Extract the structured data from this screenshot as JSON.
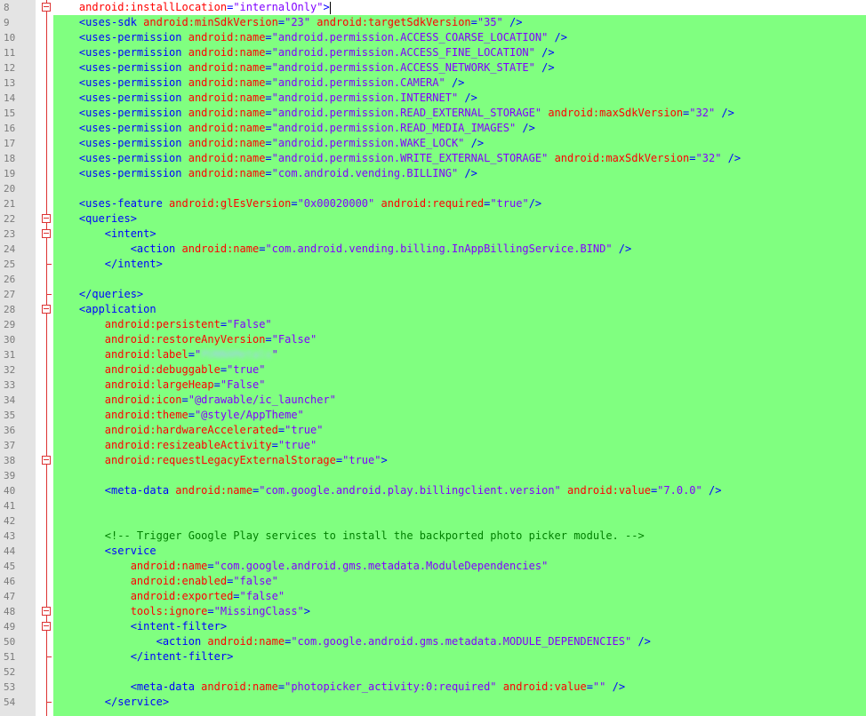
{
  "editor": {
    "lines": [
      {
        "n": "8",
        "fold": "box",
        "segments": [
          {
            "c": "a",
            "t": "    android:installLocation"
          },
          {
            "c": "t",
            "t": "="
          },
          {
            "c": "v",
            "t": "\"internalOnly\""
          },
          {
            "c": "t",
            "t": ">"
          }
        ]
      },
      {
        "n": "9",
        "fold": "",
        "segments": [
          {
            "c": "t",
            "t": "    <uses-sdk "
          },
          {
            "c": "a",
            "t": "android:minSdkVersion"
          },
          {
            "c": "t",
            "t": "="
          },
          {
            "c": "v",
            "t": "\"23\""
          },
          {
            "c": "t",
            "t": " "
          },
          {
            "c": "a",
            "t": "android:targetSdkVersion"
          },
          {
            "c": "t",
            "t": "="
          },
          {
            "c": "v",
            "t": "\"35\""
          },
          {
            "c": "t",
            "t": " />"
          }
        ]
      },
      {
        "n": "10",
        "fold": "",
        "segments": [
          {
            "c": "t",
            "t": "    <uses-permission "
          },
          {
            "c": "a",
            "t": "android:name"
          },
          {
            "c": "t",
            "t": "="
          },
          {
            "c": "v",
            "t": "\"android.permission.ACCESS_COARSE_LOCATION\""
          },
          {
            "c": "t",
            "t": " />"
          }
        ]
      },
      {
        "n": "11",
        "fold": "",
        "segments": [
          {
            "c": "t",
            "t": "    <uses-permission "
          },
          {
            "c": "a",
            "t": "android:name"
          },
          {
            "c": "t",
            "t": "="
          },
          {
            "c": "v",
            "t": "\"android.permission.ACCESS_FINE_LOCATION\""
          },
          {
            "c": "t",
            "t": " />"
          }
        ]
      },
      {
        "n": "12",
        "fold": "",
        "segments": [
          {
            "c": "t",
            "t": "    <uses-permission "
          },
          {
            "c": "a",
            "t": "android:name"
          },
          {
            "c": "t",
            "t": "="
          },
          {
            "c": "v",
            "t": "\"android.permission.ACCESS_NETWORK_STATE\""
          },
          {
            "c": "t",
            "t": " />"
          }
        ]
      },
      {
        "n": "13",
        "fold": "",
        "segments": [
          {
            "c": "t",
            "t": "    <uses-permission "
          },
          {
            "c": "a",
            "t": "android:name"
          },
          {
            "c": "t",
            "t": "="
          },
          {
            "c": "v",
            "t": "\"android.permission.CAMERA\""
          },
          {
            "c": "t",
            "t": " />"
          }
        ]
      },
      {
        "n": "14",
        "fold": "",
        "segments": [
          {
            "c": "t",
            "t": "    <uses-permission "
          },
          {
            "c": "a",
            "t": "android:name"
          },
          {
            "c": "t",
            "t": "="
          },
          {
            "c": "v",
            "t": "\"android.permission.INTERNET\""
          },
          {
            "c": "t",
            "t": " />"
          }
        ]
      },
      {
        "n": "15",
        "fold": "",
        "segments": [
          {
            "c": "t",
            "t": "    <uses-permission "
          },
          {
            "c": "a",
            "t": "android:name"
          },
          {
            "c": "t",
            "t": "="
          },
          {
            "c": "v",
            "t": "\"android.permission.READ_EXTERNAL_STORAGE\""
          },
          {
            "c": "t",
            "t": " "
          },
          {
            "c": "a",
            "t": "android:maxSdkVersion"
          },
          {
            "c": "t",
            "t": "="
          },
          {
            "c": "v",
            "t": "\"32\""
          },
          {
            "c": "t",
            "t": " />"
          }
        ]
      },
      {
        "n": "16",
        "fold": "",
        "segments": [
          {
            "c": "t",
            "t": "    <uses-permission "
          },
          {
            "c": "a",
            "t": "android:name"
          },
          {
            "c": "t",
            "t": "="
          },
          {
            "c": "v",
            "t": "\"android.permission.READ_MEDIA_IMAGES\""
          },
          {
            "c": "t",
            "t": " />"
          }
        ]
      },
      {
        "n": "17",
        "fold": "",
        "segments": [
          {
            "c": "t",
            "t": "    <uses-permission "
          },
          {
            "c": "a",
            "t": "android:name"
          },
          {
            "c": "t",
            "t": "="
          },
          {
            "c": "v",
            "t": "\"android.permission.WAKE_LOCK\""
          },
          {
            "c": "t",
            "t": " />"
          }
        ]
      },
      {
        "n": "18",
        "fold": "",
        "segments": [
          {
            "c": "t",
            "t": "    <uses-permission "
          },
          {
            "c": "a",
            "t": "android:name"
          },
          {
            "c": "t",
            "t": "="
          },
          {
            "c": "v",
            "t": "\"android.permission.WRITE_EXTERNAL_STORAGE\""
          },
          {
            "c": "t",
            "t": " "
          },
          {
            "c": "a",
            "t": "android:maxSdkVersion"
          },
          {
            "c": "t",
            "t": "="
          },
          {
            "c": "v",
            "t": "\"32\""
          },
          {
            "c": "t",
            "t": " />"
          }
        ]
      },
      {
        "n": "19",
        "fold": "",
        "segments": [
          {
            "c": "t",
            "t": "    <uses-permission "
          },
          {
            "c": "a",
            "t": "android:name"
          },
          {
            "c": "t",
            "t": "="
          },
          {
            "c": "v",
            "t": "\"com.android.vending.BILLING\""
          },
          {
            "c": "t",
            "t": " />"
          }
        ]
      },
      {
        "n": "20",
        "fold": "",
        "segments": []
      },
      {
        "n": "21",
        "fold": "",
        "segments": [
          {
            "c": "t",
            "t": "    <uses-feature "
          },
          {
            "c": "a",
            "t": "android:glEsVersion"
          },
          {
            "c": "t",
            "t": "="
          },
          {
            "c": "v",
            "t": "\"0x00020000\""
          },
          {
            "c": "t",
            "t": " "
          },
          {
            "c": "a",
            "t": "android:required"
          },
          {
            "c": "t",
            "t": "="
          },
          {
            "c": "v",
            "t": "\"true\""
          },
          {
            "c": "t",
            "t": "/>"
          }
        ]
      },
      {
        "n": "22",
        "fold": "box",
        "segments": [
          {
            "c": "t",
            "t": "    <queries>"
          }
        ]
      },
      {
        "n": "23",
        "fold": "box",
        "segments": [
          {
            "c": "t",
            "t": "        <intent>"
          }
        ]
      },
      {
        "n": "24",
        "fold": "",
        "segments": [
          {
            "c": "t",
            "t": "            <action "
          },
          {
            "c": "a",
            "t": "android:name"
          },
          {
            "c": "t",
            "t": "="
          },
          {
            "c": "v",
            "t": "\"com.android.vending.billing.InAppBillingService.BIND\""
          },
          {
            "c": "t",
            "t": " />"
          }
        ]
      },
      {
        "n": "25",
        "fold": "end",
        "segments": [
          {
            "c": "t",
            "t": "        </intent>"
          }
        ]
      },
      {
        "n": "26",
        "fold": "",
        "segments": []
      },
      {
        "n": "27",
        "fold": "end",
        "segments": [
          {
            "c": "t",
            "t": "    </queries>"
          }
        ]
      },
      {
        "n": "28",
        "fold": "box",
        "segments": [
          {
            "c": "t",
            "t": "    <application"
          }
        ]
      },
      {
        "n": "29",
        "fold": "",
        "segments": [
          {
            "c": "a",
            "t": "        android:persistent"
          },
          {
            "c": "t",
            "t": "="
          },
          {
            "c": "v",
            "t": "\"False\""
          }
        ]
      },
      {
        "n": "30",
        "fold": "",
        "segments": [
          {
            "c": "a",
            "t": "        android:restoreAnyVersion"
          },
          {
            "c": "t",
            "t": "="
          },
          {
            "c": "v",
            "t": "\"False\""
          }
        ]
      },
      {
        "n": "31",
        "fold": "",
        "segments": [
          {
            "c": "a",
            "t": "        android:label"
          },
          {
            "c": "t",
            "t": "="
          },
          {
            "c": "v",
            "t": "\""
          },
          {
            "c": "blur",
            "t": "PUNNAMetals"
          },
          {
            "c": "v",
            "t": "\""
          }
        ]
      },
      {
        "n": "32",
        "fold": "",
        "segments": [
          {
            "c": "a",
            "t": "        android:debuggable"
          },
          {
            "c": "t",
            "t": "="
          },
          {
            "c": "v",
            "t": "\"true\""
          }
        ]
      },
      {
        "n": "33",
        "fold": "",
        "segments": [
          {
            "c": "a",
            "t": "        android:largeHeap"
          },
          {
            "c": "t",
            "t": "="
          },
          {
            "c": "v",
            "t": "\"False\""
          }
        ]
      },
      {
        "n": "34",
        "fold": "",
        "segments": [
          {
            "c": "a",
            "t": "        android:icon"
          },
          {
            "c": "t",
            "t": "="
          },
          {
            "c": "v",
            "t": "\"@drawable/ic_launcher\""
          }
        ]
      },
      {
        "n": "35",
        "fold": "",
        "segments": [
          {
            "c": "a",
            "t": "        android:theme"
          },
          {
            "c": "t",
            "t": "="
          },
          {
            "c": "v",
            "t": "\"@style/AppTheme\""
          }
        ]
      },
      {
        "n": "36",
        "fold": "",
        "segments": [
          {
            "c": "a",
            "t": "        android:hardwareAccelerated"
          },
          {
            "c": "t",
            "t": "="
          },
          {
            "c": "v",
            "t": "\"true\""
          }
        ]
      },
      {
        "n": "37",
        "fold": "",
        "segments": [
          {
            "c": "a",
            "t": "        android:resizeableActivity"
          },
          {
            "c": "t",
            "t": "="
          },
          {
            "c": "v",
            "t": "\"true\""
          }
        ]
      },
      {
        "n": "38",
        "fold": "box",
        "segments": [
          {
            "c": "a",
            "t": "        android:requestLegacyExternalStorage"
          },
          {
            "c": "t",
            "t": "="
          },
          {
            "c": "v",
            "t": "\"true\""
          },
          {
            "c": "t",
            "t": ">"
          }
        ]
      },
      {
        "n": "39",
        "fold": "",
        "segments": []
      },
      {
        "n": "40",
        "fold": "",
        "segments": [
          {
            "c": "t",
            "t": "        <meta-data "
          },
          {
            "c": "a",
            "t": "android:name"
          },
          {
            "c": "t",
            "t": "="
          },
          {
            "c": "v",
            "t": "\"com.google.android.play.billingclient.version\""
          },
          {
            "c": "t",
            "t": " "
          },
          {
            "c": "a",
            "t": "android:value"
          },
          {
            "c": "t",
            "t": "="
          },
          {
            "c": "v",
            "t": "\"7.0.0\""
          },
          {
            "c": "t",
            "t": " />"
          }
        ]
      },
      {
        "n": "41",
        "fold": "",
        "segments": []
      },
      {
        "n": "42",
        "fold": "",
        "segments": []
      },
      {
        "n": "43",
        "fold": "",
        "segments": [
          {
            "c": "c",
            "t": "        <!-- Trigger Google Play services to install the backported photo picker module. -->"
          }
        ]
      },
      {
        "n": "44",
        "fold": "",
        "segments": [
          {
            "c": "t",
            "t": "        <service"
          }
        ]
      },
      {
        "n": "45",
        "fold": "",
        "segments": [
          {
            "c": "a",
            "t": "            android:name"
          },
          {
            "c": "t",
            "t": "="
          },
          {
            "c": "v",
            "t": "\"com.google.android.gms.metadata.ModuleDependencies\""
          }
        ]
      },
      {
        "n": "46",
        "fold": "",
        "segments": [
          {
            "c": "a",
            "t": "            android:enabled"
          },
          {
            "c": "t",
            "t": "="
          },
          {
            "c": "v",
            "t": "\"false\""
          }
        ]
      },
      {
        "n": "47",
        "fold": "",
        "segments": [
          {
            "c": "a",
            "t": "            android:exported"
          },
          {
            "c": "t",
            "t": "="
          },
          {
            "c": "v",
            "t": "\"false\""
          }
        ]
      },
      {
        "n": "48",
        "fold": "box",
        "segments": [
          {
            "c": "a",
            "t": "            tools:ignore"
          },
          {
            "c": "t",
            "t": "="
          },
          {
            "c": "v",
            "t": "\"MissingClass\""
          },
          {
            "c": "t",
            "t": ">"
          }
        ]
      },
      {
        "n": "49",
        "fold": "box",
        "segments": [
          {
            "c": "t",
            "t": "            <intent-filter>"
          }
        ]
      },
      {
        "n": "50",
        "fold": "",
        "segments": [
          {
            "c": "t",
            "t": "                <action "
          },
          {
            "c": "a",
            "t": "android:name"
          },
          {
            "c": "t",
            "t": "="
          },
          {
            "c": "v",
            "t": "\"com.google.android.gms.metadata.MODULE_DEPENDENCIES\""
          },
          {
            "c": "t",
            "t": " />"
          }
        ]
      },
      {
        "n": "51",
        "fold": "end",
        "segments": [
          {
            "c": "t",
            "t": "            </intent-filter>"
          }
        ]
      },
      {
        "n": "52",
        "fold": "",
        "segments": []
      },
      {
        "n": "53",
        "fold": "",
        "segments": [
          {
            "c": "t",
            "t": "            <meta-data "
          },
          {
            "c": "a",
            "t": "android:name"
          },
          {
            "c": "t",
            "t": "="
          },
          {
            "c": "v",
            "t": "\"photopicker_activity:0:required\""
          },
          {
            "c": "t",
            "t": " "
          },
          {
            "c": "a",
            "t": "android:value"
          },
          {
            "c": "t",
            "t": "="
          },
          {
            "c": "v",
            "t": "\"\""
          },
          {
            "c": "t",
            "t": " />"
          }
        ]
      },
      {
        "n": "54",
        "fold": "end",
        "segments": [
          {
            "c": "t",
            "t": "        </service>"
          }
        ]
      }
    ]
  }
}
